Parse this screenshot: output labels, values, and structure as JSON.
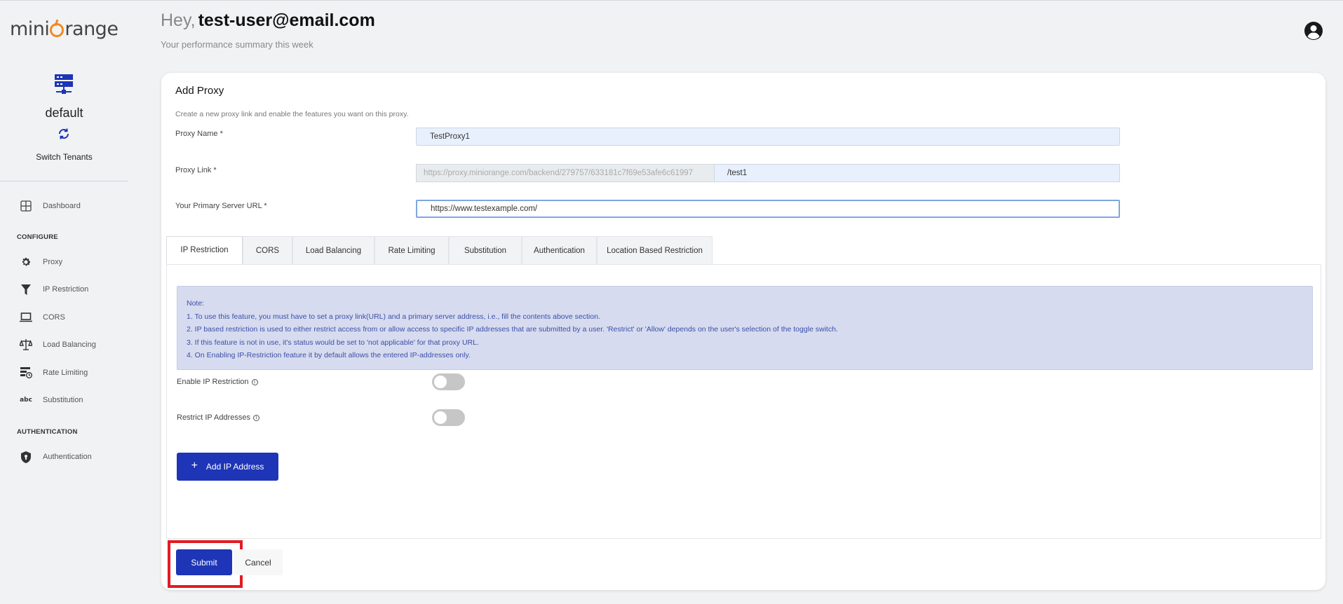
{
  "brand": {
    "logo_text_1": "mini",
    "logo_text_2": "range",
    "accent": "#f28a1e"
  },
  "sidebar": {
    "tenant_name": "default",
    "switch_label": "Switch Tenants",
    "dashboard": "Dashboard",
    "section_configure": "CONFIGURE",
    "items": [
      {
        "label": "Proxy",
        "icon": "gear-icon"
      },
      {
        "label": "IP Restriction",
        "icon": "filter-icon"
      },
      {
        "label": "CORS",
        "icon": "laptop-icon"
      },
      {
        "label": "Load Balancing",
        "icon": "scale-icon"
      },
      {
        "label": "Rate Limiting",
        "icon": "rate-limit-icon"
      },
      {
        "label": "Substitution",
        "icon": "abc-icon"
      }
    ],
    "section_auth": "AUTHENTICATION",
    "auth_item": "Authentication"
  },
  "header": {
    "greeting": "Hey,",
    "user": "test-user@email.com",
    "subtitle": "Your performance summary this week"
  },
  "form": {
    "title": "Add Proxy",
    "description": "Create a new proxy link and enable the features you want on this proxy.",
    "proxy_name_label": "Proxy Name",
    "proxy_name_value": "TestProxy1",
    "proxy_link_label": "Proxy Link",
    "proxy_link_prefix": "https://proxy.miniorange.com/backend/279757/633181c7f69e53afe6c61997",
    "proxy_link_suffix": "/test1",
    "server_url_label": "Your Primary Server URL",
    "server_url_value": "https://www.testexample.com/",
    "required_mark": "*"
  },
  "tabs": [
    "IP Restriction",
    "CORS",
    "Load Balancing",
    "Rate Limiting",
    "Substitution",
    "Authentication",
    "Location Based Restriction"
  ],
  "note": {
    "heading": "Note:",
    "lines": [
      "1. To use this feature, you must have to set a proxy link(URL) and a primary server address, i.e., fill the contents above section.",
      "2. IP based restriction is used to either restrict access from or allow access to specific IP addresses that are submitted by a user. 'Restrict' or 'Allow' depends on the user's selection of the toggle switch.",
      "3. If this feature is not in use, it's status would be set to 'not applicable' for that proxy URL.",
      "4. On Enabling IP-Restriction feature it by default allows the entered IP-addresses only."
    ]
  },
  "toggles": {
    "enable_label": "Enable IP Restriction",
    "restrict_label": "Restrict IP Addresses",
    "enable_on": false,
    "restrict_on": false
  },
  "buttons": {
    "add_ip": "Add IP Address",
    "add_ip_plus": "+",
    "submit": "Submit",
    "cancel": "Cancel"
  },
  "info_glyph": "i"
}
